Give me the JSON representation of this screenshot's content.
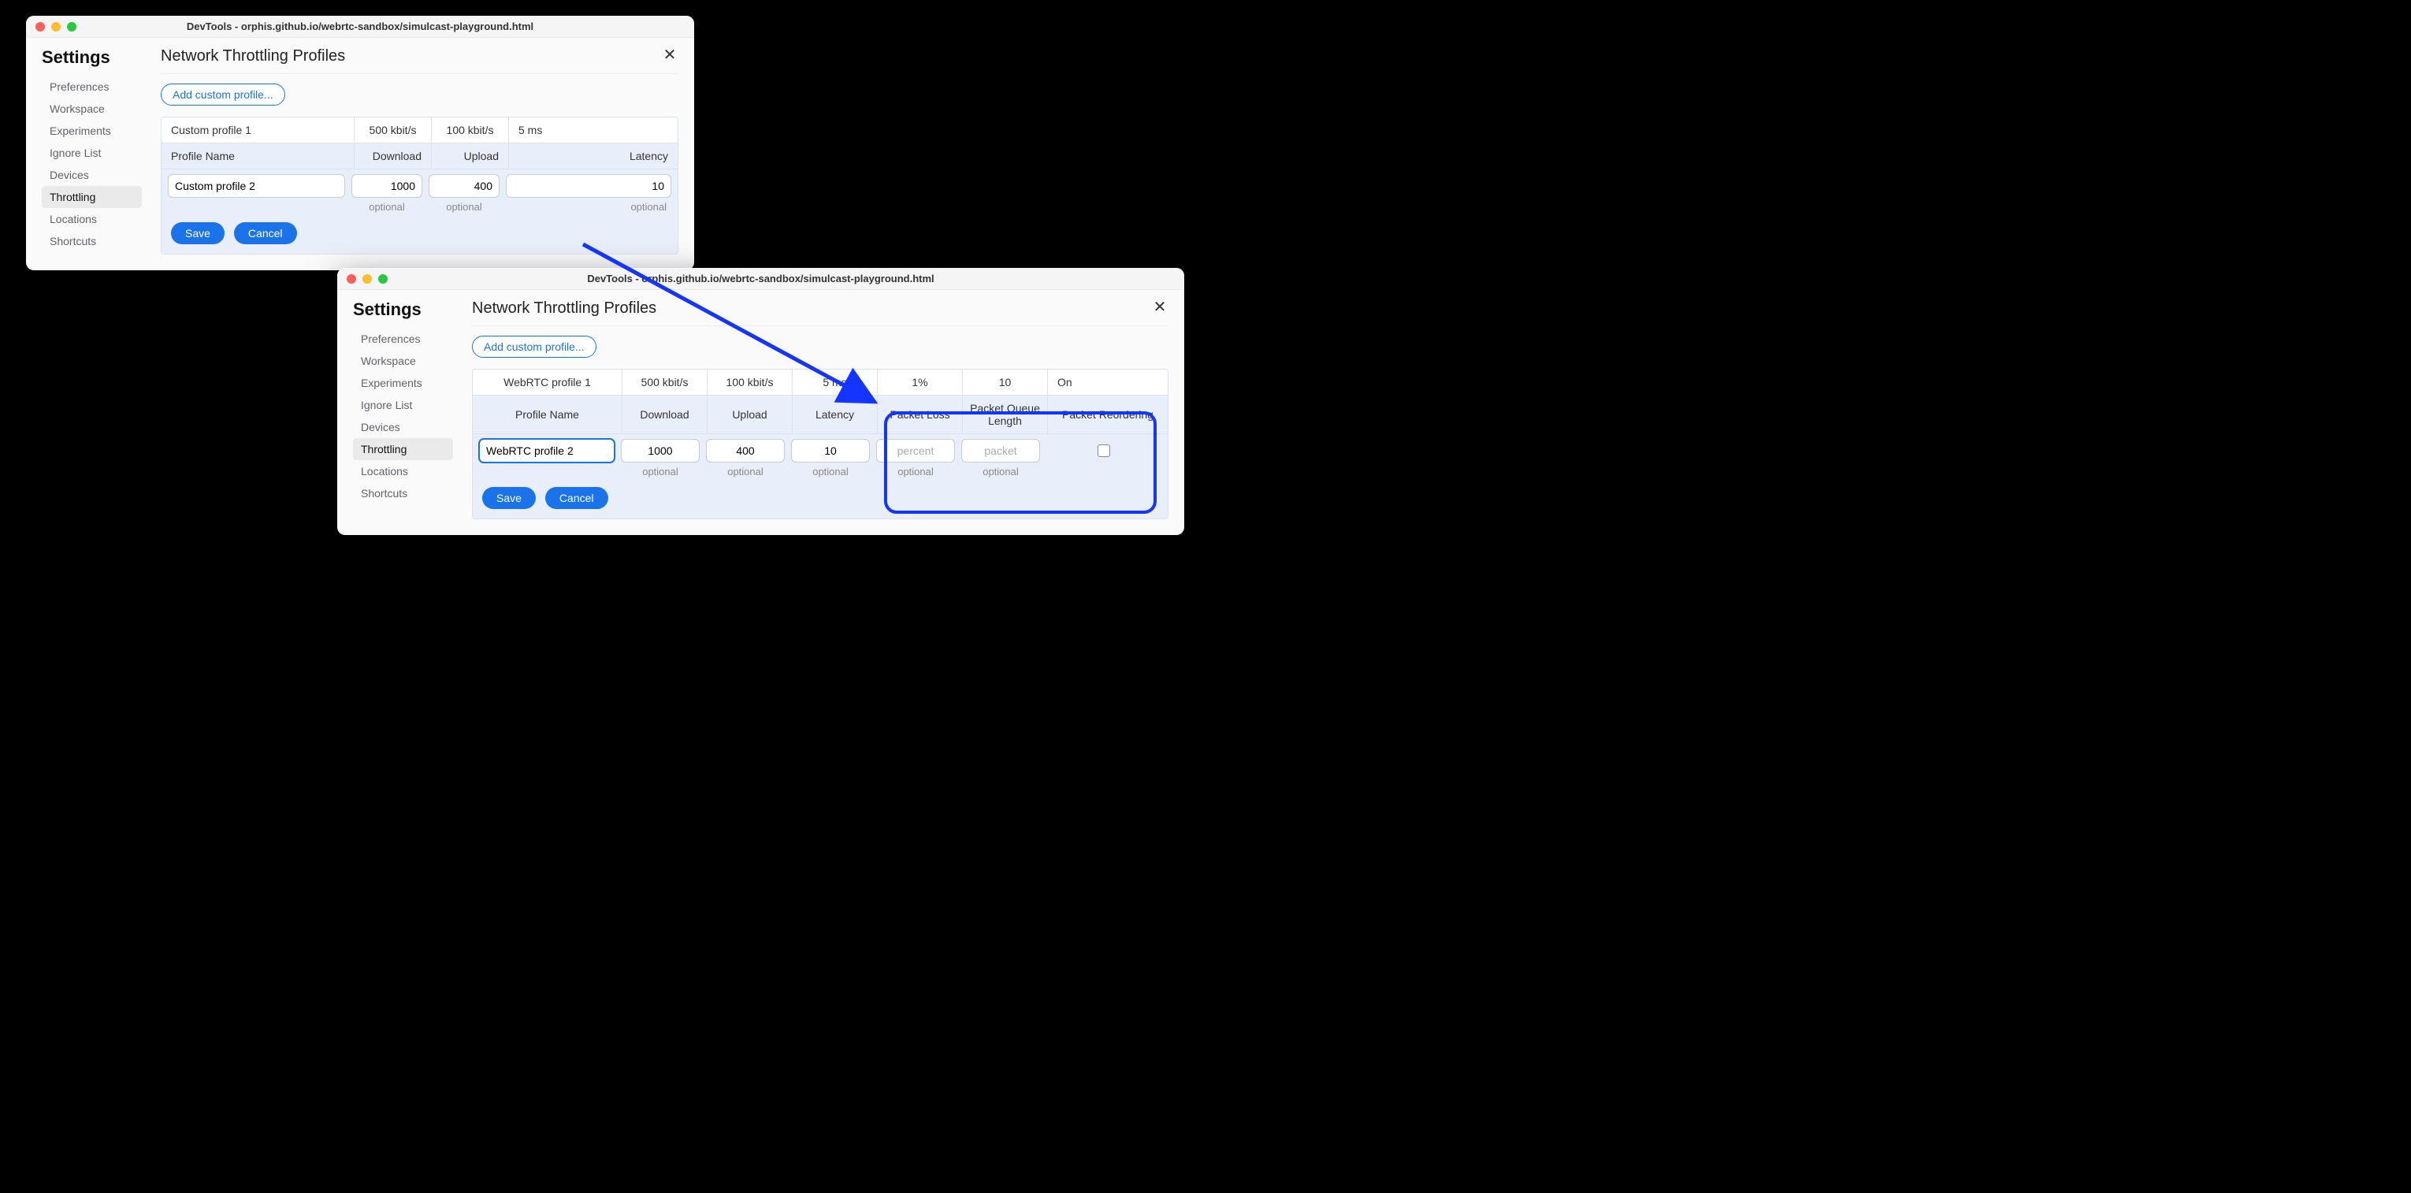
{
  "windowA": {
    "title": "DevTools - orphis.github.io/webrtc-sandbox/simulcast-playground.html",
    "settings_heading": "Settings",
    "sidebar": [
      "Preferences",
      "Workspace",
      "Experiments",
      "Ignore List",
      "Devices",
      "Throttling",
      "Locations",
      "Shortcuts"
    ],
    "selected_sidebar_index": 5,
    "panel_title": "Network Throttling Profiles",
    "add_btn": "Add custom profile...",
    "existing_row": {
      "name": "Custom profile 1",
      "download": "500 kbit/s",
      "upload": "100 kbit/s",
      "latency": "5 ms"
    },
    "header_row": {
      "name": "Profile Name",
      "download": "Download",
      "upload": "Upload",
      "latency": "Latency"
    },
    "edit_values": {
      "name": "Custom profile 2",
      "download": "1000",
      "upload": "400",
      "latency": "10"
    },
    "hints": {
      "download": "optional",
      "upload": "optional",
      "latency": "optional"
    },
    "save": "Save",
    "cancel": "Cancel"
  },
  "windowB": {
    "title": "DevTools - orphis.github.io/webrtc-sandbox/simulcast-playground.html",
    "settings_heading": "Settings",
    "sidebar": [
      "Preferences",
      "Workspace",
      "Experiments",
      "Ignore List",
      "Devices",
      "Throttling",
      "Locations",
      "Shortcuts"
    ],
    "selected_sidebar_index": 5,
    "panel_title": "Network Throttling Profiles",
    "add_btn": "Add custom profile...",
    "existing_row": {
      "name": "WebRTC profile 1",
      "download": "500 kbit/s",
      "upload": "100 kbit/s",
      "latency": "5 ms",
      "loss": "1%",
      "queue": "10",
      "reorder": "On"
    },
    "header_row": {
      "name": "Profile Name",
      "download": "Download",
      "upload": "Upload",
      "latency": "Latency",
      "loss": "Packet Loss",
      "queue": "Packet Queue Length",
      "reorder": "Packet Reordering"
    },
    "edit_values": {
      "name": "WebRTC profile 2",
      "download": "1000",
      "upload": "400",
      "latency": "10"
    },
    "placeholders": {
      "loss": "percent",
      "queue": "packet"
    },
    "hints": {
      "download": "optional",
      "upload": "optional",
      "latency": "optional",
      "loss": "optional",
      "queue": "optional"
    },
    "save": "Save",
    "cancel": "Cancel"
  }
}
